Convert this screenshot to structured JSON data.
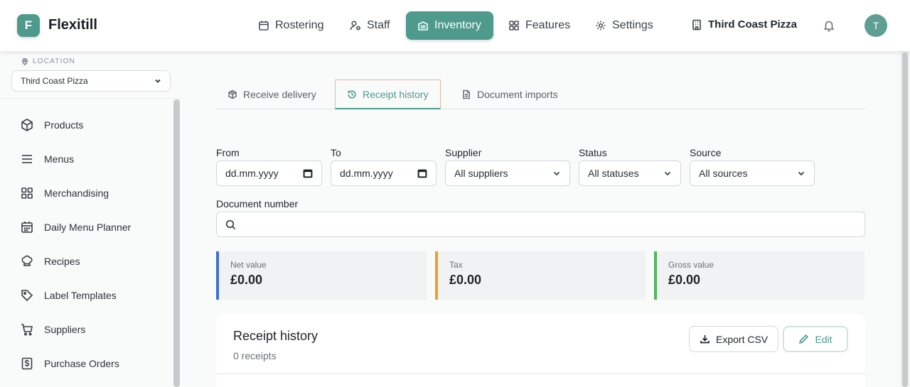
{
  "brand": {
    "initial": "F",
    "name": "Flexitill"
  },
  "nav": {
    "items": [
      {
        "label": "Rostering",
        "icon": "calendar-icon"
      },
      {
        "label": "Staff",
        "icon": "staff-icon"
      },
      {
        "label": "Inventory",
        "icon": "inventory-icon",
        "active": true
      },
      {
        "label": "Features",
        "icon": "grid-icon"
      },
      {
        "label": "Settings",
        "icon": "gear-icon"
      }
    ],
    "store": "Third Coast Pizza",
    "avatar_initial": "T"
  },
  "sidebar": {
    "location_label": "LOCATION",
    "location_value": "Third Coast Pizza",
    "items": [
      {
        "label": "Products",
        "icon": "box-icon"
      },
      {
        "label": "Menus",
        "icon": "menu-icon"
      },
      {
        "label": "Merchandising",
        "icon": "grid-icon"
      },
      {
        "label": "Daily Menu Planner",
        "icon": "calendar-icon"
      },
      {
        "label": "Recipes",
        "icon": "chef-hat-icon"
      },
      {
        "label": "Label Templates",
        "icon": "tag-icon"
      },
      {
        "label": "Suppliers",
        "icon": "cart-icon"
      },
      {
        "label": "Purchase Orders",
        "icon": "dollar-doc-icon"
      }
    ]
  },
  "tabs": [
    {
      "label": "Receive delivery",
      "icon": "package-icon"
    },
    {
      "label": "Receipt history",
      "icon": "history-icon",
      "active": true
    },
    {
      "label": "Document imports",
      "icon": "document-icon"
    }
  ],
  "filters": {
    "from_label": "From",
    "from_value": "dd.mm.yyyy",
    "to_label": "To",
    "to_value": "dd.mm.yyyy",
    "supplier_label": "Supplier",
    "supplier_value": "All suppliers",
    "status_label": "Status",
    "status_value": "All statuses",
    "source_label": "Source",
    "source_value": "All sources",
    "docnum_label": "Document number",
    "docnum_value": ""
  },
  "summary": [
    {
      "label": "Net value",
      "value": "£0.00",
      "color": "#3f6fd6"
    },
    {
      "label": "Tax",
      "value": "£0.00",
      "color": "#e8a026"
    },
    {
      "label": "Gross value",
      "value": "£0.00",
      "color": "#4fb85a"
    }
  ],
  "receipts": {
    "title": "Receipt history",
    "count": "0 receipts",
    "export_label": "Export CSV",
    "edit_label": "Edit"
  },
  "colors": {
    "accent": "#4e9a8c"
  }
}
